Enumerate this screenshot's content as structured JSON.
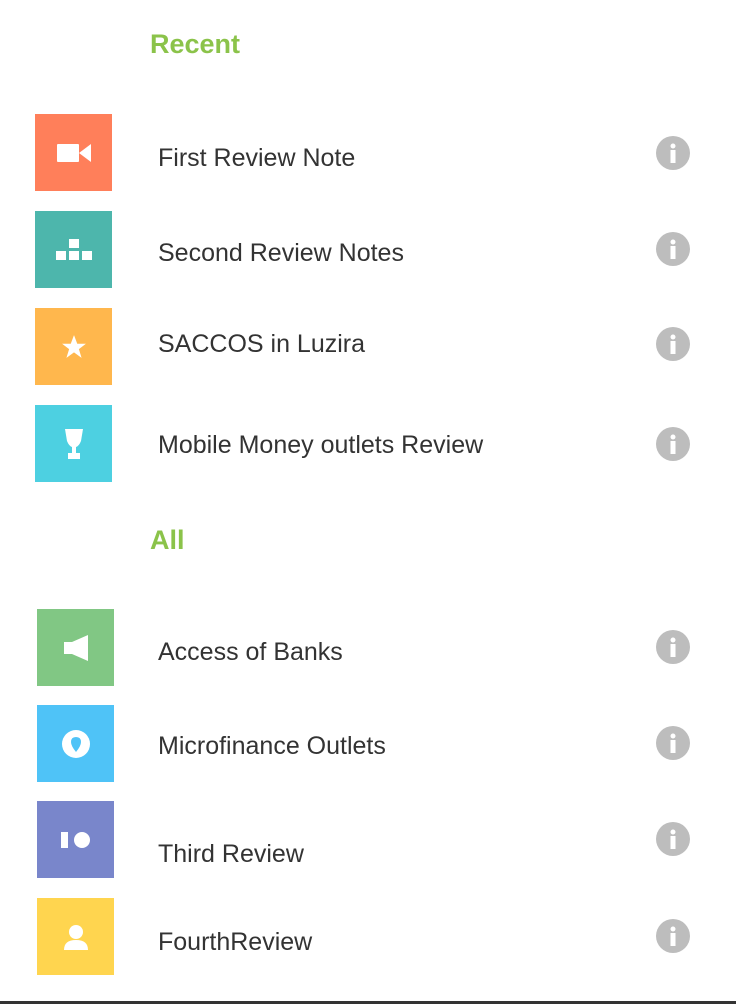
{
  "recent": {
    "header": "Recent",
    "items": [
      {
        "label": "First Review Note",
        "icon": "video-camera-icon",
        "color": "#ff7f5a"
      },
      {
        "label": "Second Review Notes",
        "icon": "blocks-icon",
        "color": "#4db6ac"
      },
      {
        "label": "SACCOS in Luzira",
        "icon": "star-icon",
        "color": "#ffb74d"
      },
      {
        "label": "Mobile Money outlets Review",
        "icon": "trophy-icon",
        "color": "#4dd0e1"
      }
    ]
  },
  "all": {
    "header": "All",
    "items": [
      {
        "label": "Access of Banks",
        "icon": "megaphone-icon",
        "color": "#81c784"
      },
      {
        "label": "Microfinance Outlets",
        "icon": "map-pin-icon",
        "color": "#4fc3f7"
      },
      {
        "label": "Third Review",
        "icon": "toggle-icon",
        "color": "#7986cb"
      },
      {
        "label": "FourthReview",
        "icon": "person-icon",
        "color": "#ffd54f"
      }
    ]
  },
  "info_icon": "info-icon",
  "accent_color": "#8bc34a",
  "info_color": "#bdbdbd"
}
